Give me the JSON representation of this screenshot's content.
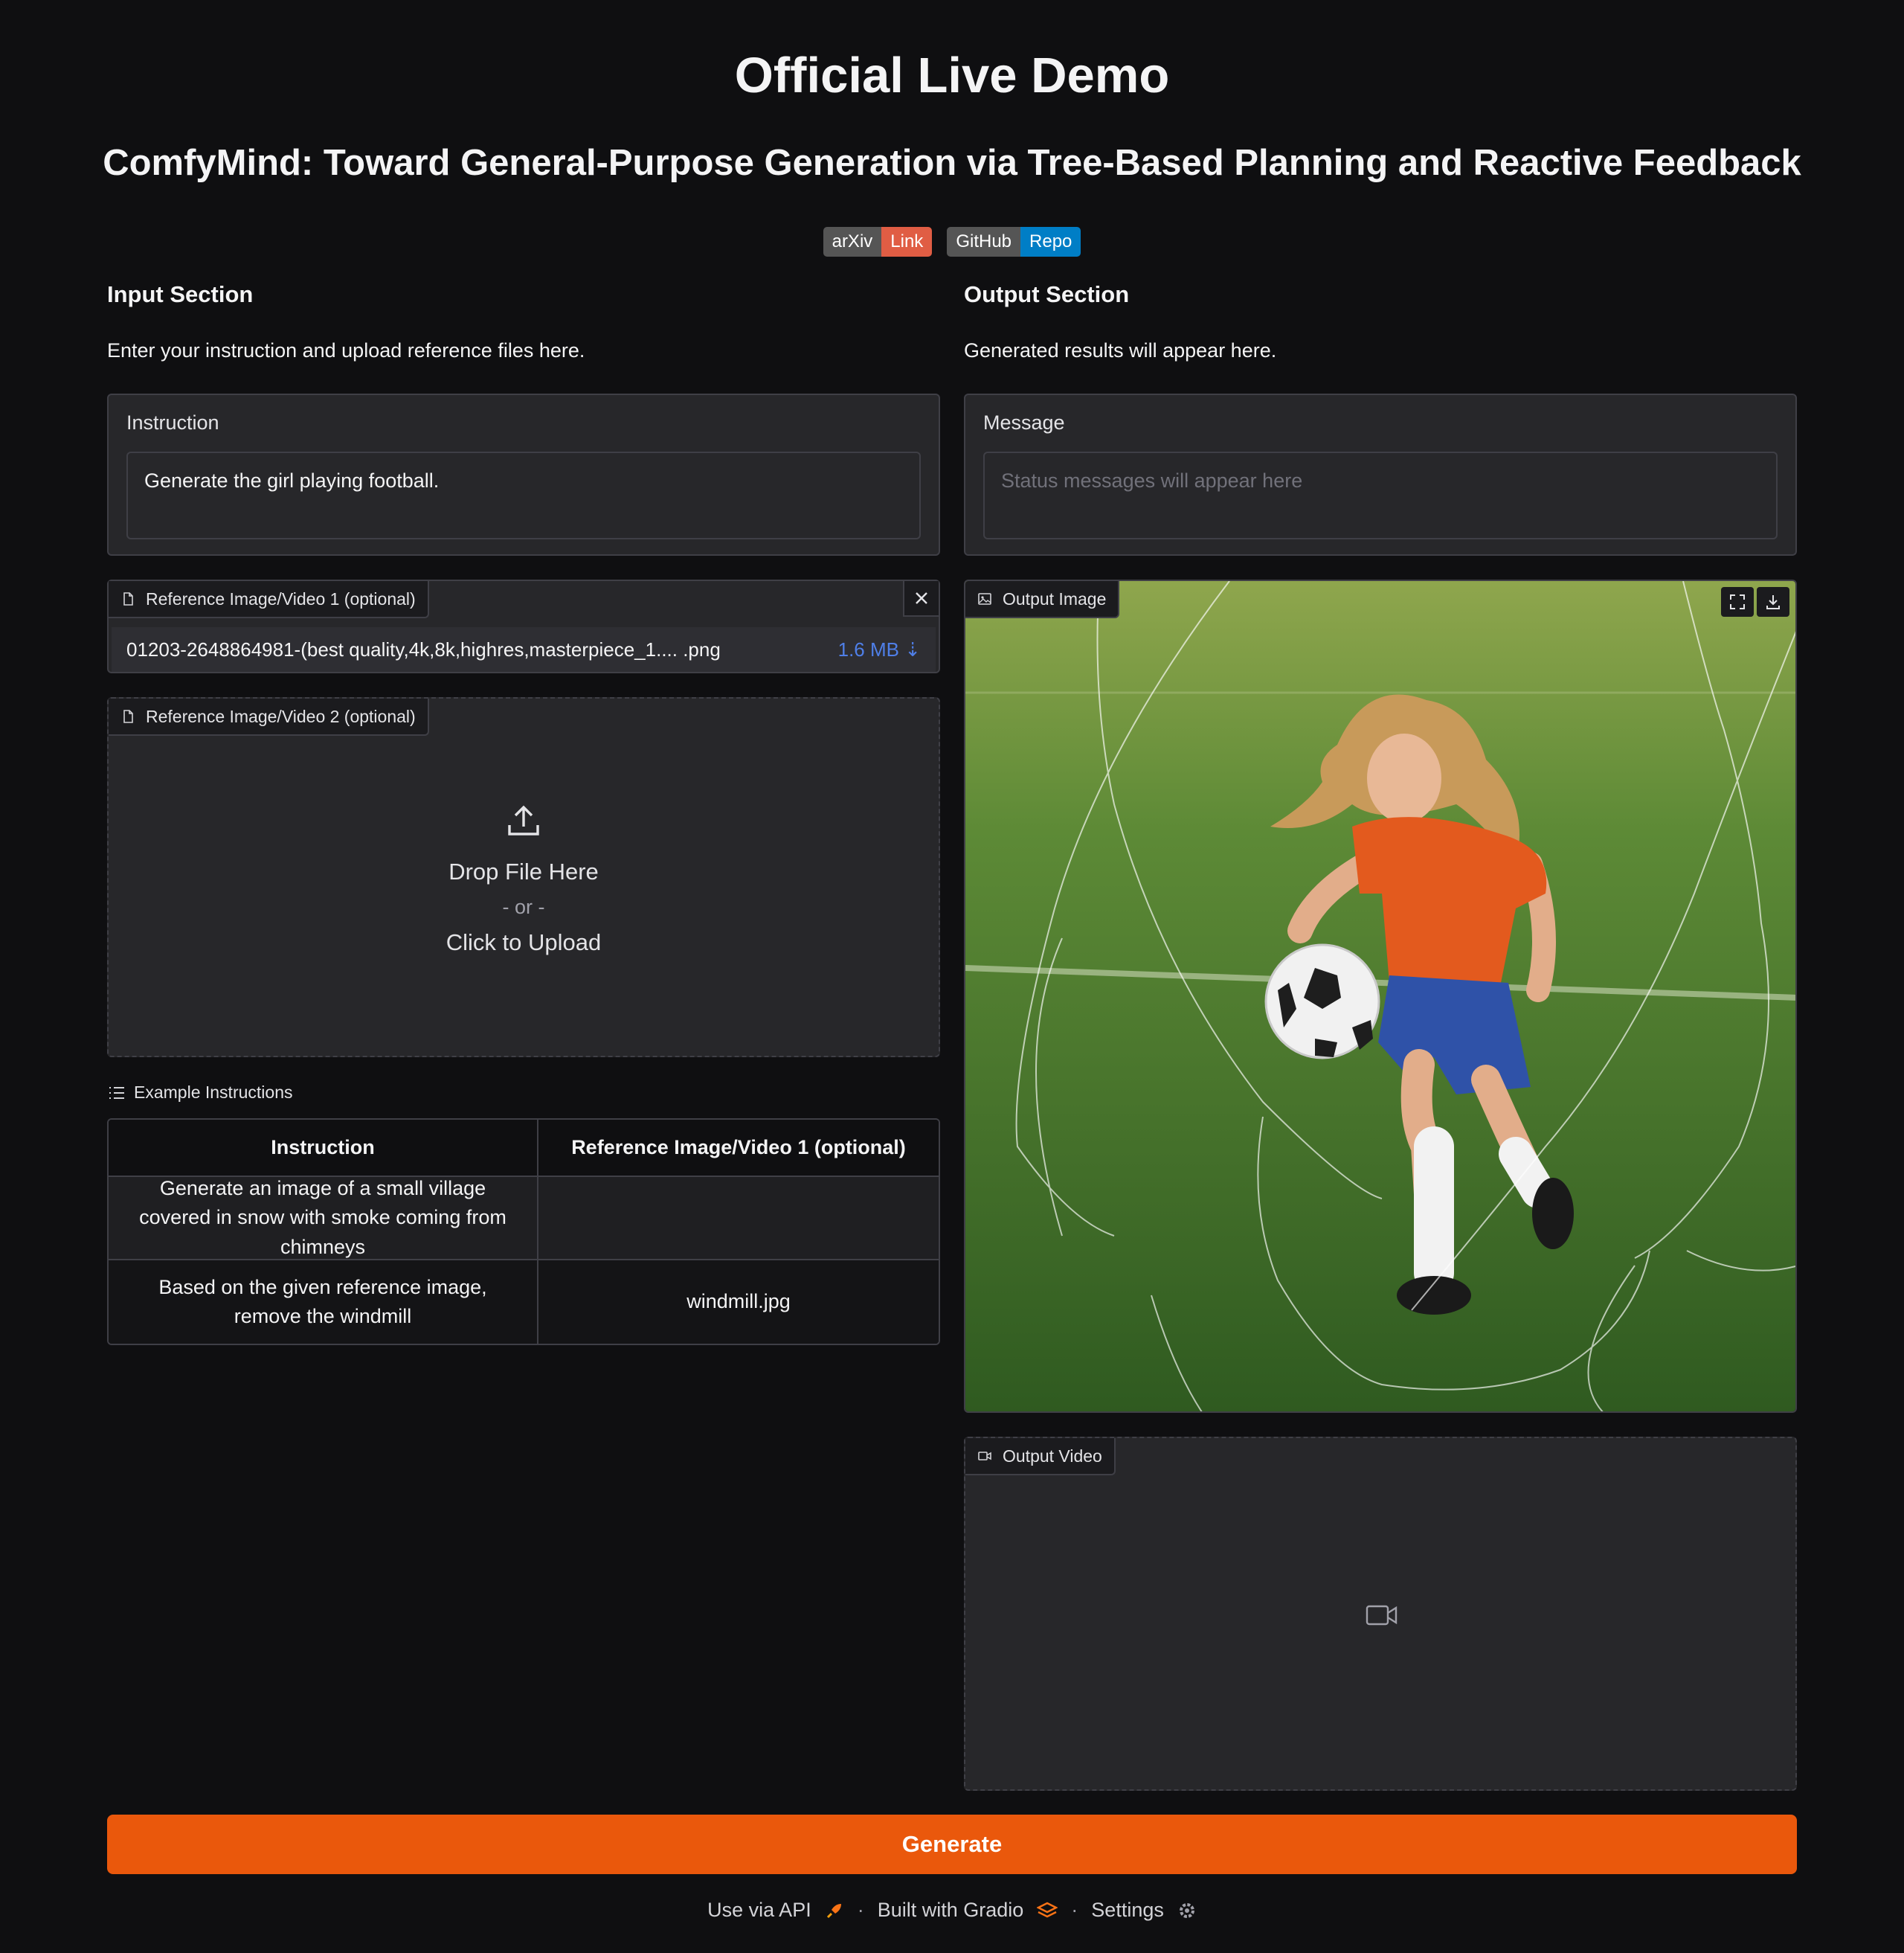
{
  "header": {
    "title": "Official Live Demo",
    "subtitle": "ComfyMind: Toward General-Purpose Generation via Tree-Based Planning and Reactive Feedback",
    "badges": [
      {
        "left": "arXiv",
        "right": "Link",
        "color": "#e05d44"
      },
      {
        "left": "GitHub",
        "right": "Repo",
        "color": "#007ec6"
      }
    ]
  },
  "input": {
    "title": "Input Section",
    "description": "Enter your instruction and upload reference files here.",
    "instruction_label": "Instruction",
    "instruction_value": "Generate the girl playing football.",
    "ref1": {
      "label": "Reference Image/Video 1 (optional)",
      "file_name": "01203-2648864981-(best quality,4k,8k,highres,masterpiece_1.... .png",
      "file_size": "1.6 MB ⇣"
    },
    "ref2": {
      "label": "Reference Image/Video 2 (optional)",
      "drop_text": "Drop File Here",
      "or_text": "- or -",
      "click_text": "Click to Upload"
    }
  },
  "examples": {
    "label": "Example Instructions",
    "headers": [
      "Instruction",
      "Reference Image/Video 1 (optional)"
    ],
    "rows": [
      {
        "instruction": "Generate an image of a small village covered in snow with smoke coming from chimneys",
        "reference": ""
      },
      {
        "instruction": "Based on the given reference image, remove the windmill",
        "reference": "windmill.jpg"
      }
    ]
  },
  "output": {
    "title": "Output Section",
    "description": "Generated results will appear here.",
    "message_label": "Message",
    "message_placeholder": "Status messages will appear here",
    "image_label": "Output Image",
    "video_label": "Output Video"
  },
  "actions": {
    "generate_label": "Generate"
  },
  "footer": {
    "api": "Use via API",
    "built": "Built with Gradio",
    "settings": "Settings"
  },
  "colors": {
    "background": "#0f0f11",
    "panel": "#27272a",
    "accent": "#ea580c",
    "link": "#4f7fe8"
  }
}
